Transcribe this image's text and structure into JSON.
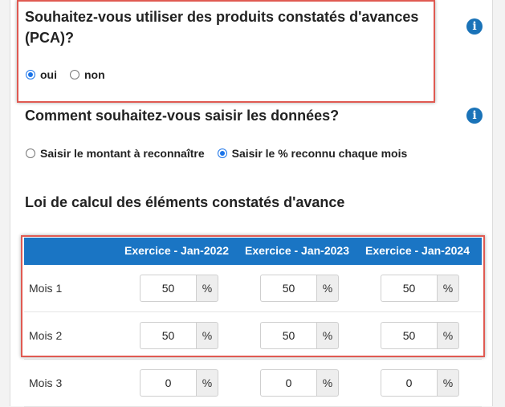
{
  "pca": {
    "title_line1": "Souhaitez-vous utiliser des produits constatés d'avances",
    "title_line2": "(PCA)?",
    "options": [
      "oui",
      "non"
    ],
    "selected": "oui"
  },
  "input_method": {
    "title": "Comment souhaitez-vous saisir les données?",
    "options": [
      "Saisir le montant à reconnaître",
      "Saisir le % reconnu chaque mois"
    ],
    "selected": "Saisir le % reconnu chaque mois"
  },
  "law": {
    "title": "Loi de calcul des éléments constatés d'avance",
    "columns": [
      "Exercice - Jan-2022",
      "Exercice - Jan-2023",
      "Exercice - Jan-2024"
    ],
    "unit": "%",
    "rows": [
      {
        "label": "Mois 1",
        "values": [
          "50",
          "50",
          "50"
        ]
      },
      {
        "label": "Mois 2",
        "values": [
          "50",
          "50",
          "50"
        ]
      },
      {
        "label": "Mois 3",
        "values": [
          "0",
          "0",
          "0"
        ]
      }
    ]
  },
  "icons": {
    "info": "info-icon"
  },
  "colors": {
    "accent": "#1a75c4",
    "highlight": "#e05a52",
    "radio": "#1a73e8"
  }
}
